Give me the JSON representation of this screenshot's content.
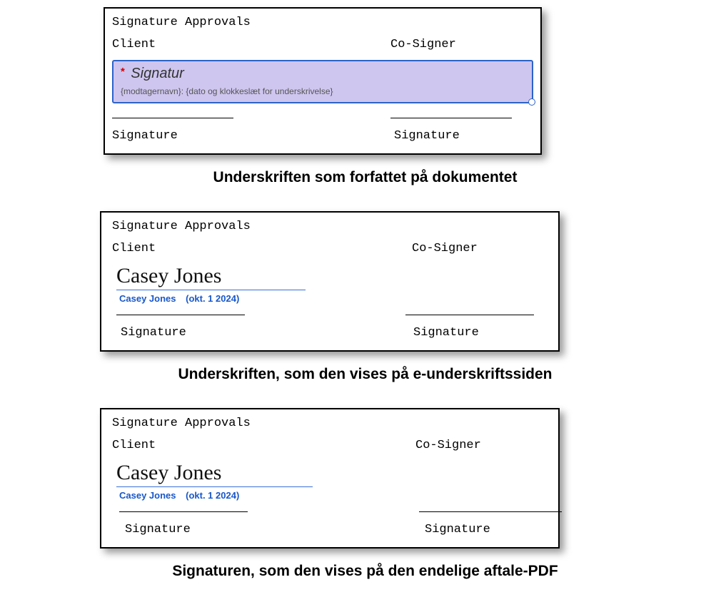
{
  "panel1": {
    "title": "Signature Approvals",
    "role_left": "Client",
    "role_right": "Co-Signer",
    "sig_placeholder": "Signatur",
    "sig_meta": "{modtagernavn}: {dato og klokkeslæt for underskrivelse}",
    "sig_label_left": "Signature",
    "sig_label_right": "Signature"
  },
  "caption1": "Underskriften som forfattet på dokumentet",
  "panel2": {
    "title": "Signature Approvals",
    "role_left": "Client",
    "role_right": "Co-Signer",
    "signed_name": "Casey Jones",
    "meta_name": "Casey Jones",
    "meta_date": "(okt. 1 2024)",
    "sig_label_left": "Signature",
    "sig_label_right": "Signature"
  },
  "caption2": "Underskriften, som den vises på e-underskriftssiden",
  "panel3": {
    "title": "Signature Approvals",
    "role_left": "Client",
    "role_right": "Co-Signer",
    "signed_name": "Casey Jones",
    "meta_name": "Casey Jones",
    "meta_date": "(okt. 1 2024)",
    "sig_label_left": "Signature",
    "sig_label_right": "Signature"
  },
  "caption3": "Signaturen, som den vises på den endelige aftale-PDF"
}
